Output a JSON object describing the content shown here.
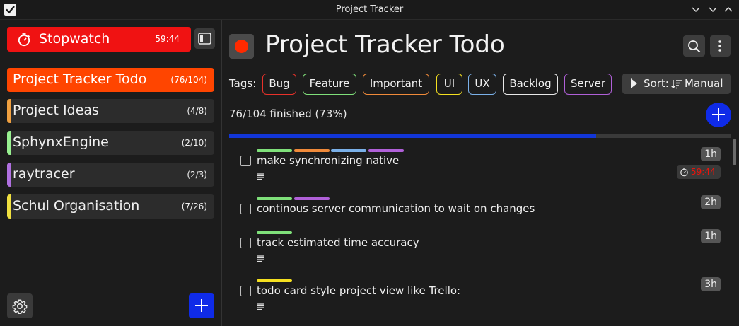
{
  "window": {
    "title": "Project Tracker"
  },
  "sidebar": {
    "stopwatch": {
      "label": "Stopwatch",
      "time": "59:44"
    },
    "projects": [
      {
        "name": "Project Tracker Todo",
        "count": "(76/104)",
        "color": "#ff4500",
        "active": true
      },
      {
        "name": "Project Ideas",
        "count": "(4/8)",
        "color": "#f0a040",
        "active": false
      },
      {
        "name": "SphynxEngine",
        "count": "(2/10)",
        "color": "#98f090",
        "active": false
      },
      {
        "name": "raytracer",
        "count": "(2/3)",
        "color": "#b070e0",
        "active": false
      },
      {
        "name": "Schul Organisation",
        "count": "(7/26)",
        "color": "#f0e040",
        "active": false
      }
    ],
    "add_button_icon": "plus-icon",
    "settings_icon": "gear-icon"
  },
  "main": {
    "title": "Project Tracker Todo",
    "tags_label": "Tags:",
    "tags": [
      {
        "label": "Bug",
        "color": "#e8312a"
      },
      {
        "label": "Feature",
        "color": "#7fe07a"
      },
      {
        "label": "Important",
        "color": "#f08a3a"
      },
      {
        "label": "UI",
        "color": "#f5e020"
      },
      {
        "label": "UX",
        "color": "#7ab0e8"
      },
      {
        "label": "Backlog",
        "color": "#e8e8e8"
      },
      {
        "label": "Server",
        "color": "#b060d8"
      }
    ],
    "sort": {
      "label": "Sort:",
      "value": "Manual"
    },
    "progress": {
      "text": "76/104 finished (73%)",
      "fraction": 0.73
    },
    "todos": [
      {
        "text": "make synchronizing native",
        "estimate": "1h",
        "timer": "59:44",
        "has_note": true,
        "tag_colors": [
          "#7fe07a",
          "#f08a3a",
          "#7ab0e8",
          "#b060d8"
        ]
      },
      {
        "text": "continous server communication to wait on changes",
        "estimate": "2h",
        "has_note": false,
        "tag_colors": [
          "#7fe07a",
          "#b060d8"
        ]
      },
      {
        "text": "track estimated time accuracy",
        "estimate": "1h",
        "has_note": true,
        "tag_colors": [
          "#7fe07a"
        ]
      },
      {
        "text": "todo card style project view like Trello:",
        "estimate": "3h",
        "has_note": true,
        "tag_colors": [
          "#f5e020"
        ]
      }
    ]
  }
}
